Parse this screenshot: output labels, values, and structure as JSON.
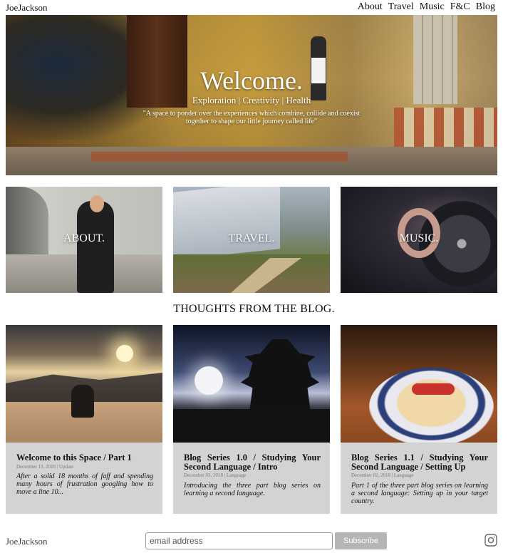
{
  "header": {
    "brand": "JoeJackson",
    "nav": [
      "About",
      "Travel",
      "Music",
      "F&C",
      "Blog"
    ]
  },
  "hero": {
    "title": "Welcome.",
    "tagline": "Exploration | Creativity | Health",
    "quote": "\"A space to ponder over the experiences which combine, collide and coexist together to shape our little journey called life\""
  },
  "tiles": [
    {
      "label": "ABOUT."
    },
    {
      "label": "TRAVEL."
    },
    {
      "label": "MUSIC."
    }
  ],
  "blog_section": {
    "title": "THOUGHTS FROM THE BLOG."
  },
  "posts": [
    {
      "title": "Welcome to this Space / Part 1",
      "meta": "December 13, 2018 | Update",
      "excerpt": "After a solid 18 months of faff and spending many hours of frustration googling how to move a line 10..."
    },
    {
      "title": "Blog Series 1.0 / Studying Your Second Language / Intro",
      "meta": "December 03, 2018 | Language",
      "excerpt": "Introducing the three part blog series on learning a second language."
    },
    {
      "title": "Blog Series 1.1 / Studying Your Second Language / Setting Up",
      "meta": "December 02, 2018 | Language",
      "excerpt": "Part 1 of the three part blog series on learning a second language: Setting up in your target country."
    }
  ],
  "footer": {
    "brand": "JoeJackson",
    "email_placeholder": "email address",
    "subscribe_label": "Subscribe",
    "social_icon": "instagram-icon"
  },
  "colors": {
    "card_bg": "#d3d3d3",
    "subscribe_bg": "#b5b5b5"
  }
}
